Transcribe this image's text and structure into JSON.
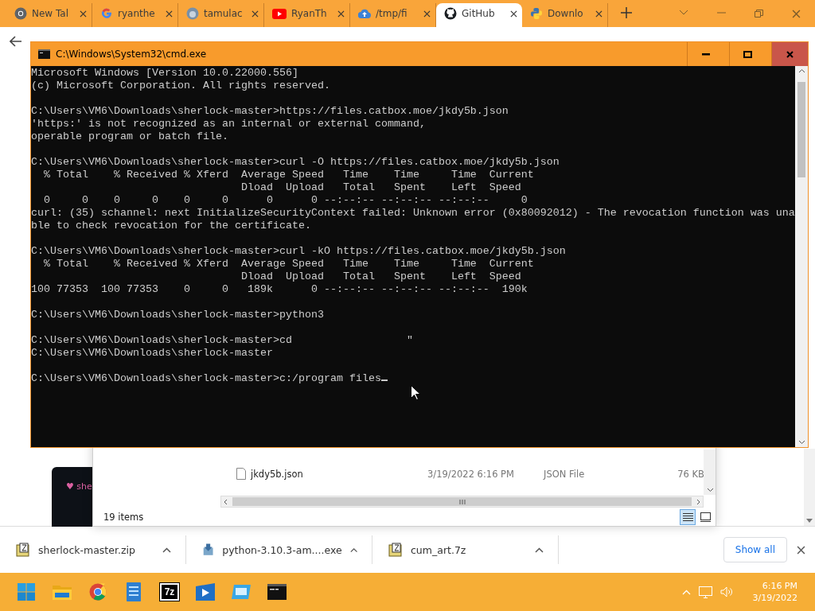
{
  "browser": {
    "tabs": [
      {
        "title": "New Tal",
        "kind": "browser",
        "selected": false
      },
      {
        "title": "ryanthe",
        "kind": "search",
        "selected": false
      },
      {
        "title": "tamulac",
        "kind": "avatar",
        "selected": false
      },
      {
        "title": "RyanTh",
        "kind": "video",
        "selected": false
      },
      {
        "title": "/tmp/fi",
        "kind": "cloud",
        "selected": false
      },
      {
        "title": "GitHub",
        "kind": "code",
        "selected": true
      },
      {
        "title": "Downlo",
        "kind": "snake",
        "selected": false
      }
    ],
    "card_text": "♥ she"
  },
  "explorer": {
    "rows": [
      {
        "name": "jkdy5b.json",
        "modified": "3/19/2022 6:16 PM",
        "type": "JSON File",
        "size": "76 KB"
      }
    ],
    "status": "19 items",
    "views": [
      {
        "kind": "details",
        "selected": true
      },
      {
        "kind": "tiles",
        "selected": false
      }
    ]
  },
  "terminal": {
    "title": "C:\\Windows\\System32\\cmd.exe",
    "blocks": [
      [
        "Microsoft Windows [Version 10.0.22000.556]",
        "(c) Microsoft Corporation. All rights reserved."
      ],
      [
        "C:\\Users\\VM6\\Downloads\\sherlock-master>https://files.catbox.moe/jkdy5b.json",
        "'https:' is not recognized as an internal or external command,",
        "operable program or batch file."
      ],
      [
        "C:\\Users\\VM6\\Downloads\\sherlock-master>curl -O https://files.catbox.moe/jkdy5b.json",
        "  % Total    % Received % Xferd  Average Speed   Time    Time     Time  Current",
        "                                 Dload  Upload   Total   Spent    Left  Speed",
        "  0     0    0     0    0     0      0      0 --:--:-- --:--:-- --:--:--     0",
        "curl: (35) schannel: next InitializeSecurityContext failed: Unknown error (0x80092012) - The revocation function was una",
        "ble to check revocation for the certificate."
      ],
      [
        "C:\\Users\\VM6\\Downloads\\sherlock-master>curl -kO https://files.catbox.moe/jkdy5b.json",
        "  % Total    % Received % Xferd  Average Speed   Time    Time     Time  Current",
        "                                 Dload  Upload   Total   Spent    Left  Speed",
        "100 77353  100 77353    0     0   189k      0 --:--:-- --:--:-- --:--:--  190k"
      ],
      [
        "C:\\Users\\VM6\\Downloads\\sherlock-master>python3"
      ],
      [
        "C:\\Users\\VM6\\Downloads\\sherlock-master>cd                  \"",
        "C:\\Users\\VM6\\Downloads\\sherlock-master"
      ]
    ],
    "input_line": "C:\\Users\\VM6\\Downloads\\sherlock-master>c:/program files"
  },
  "downloads": {
    "items": [
      {
        "name": "sherlock-master.zip",
        "kind": "archive"
      },
      {
        "name": "python-3.10.3-am....exe",
        "kind": "installer"
      },
      {
        "name": "cum_art.7z",
        "kind": "archive"
      }
    ],
    "show_all": "Show all"
  },
  "taskbar": {
    "apps": [
      {
        "kind": "start"
      },
      {
        "kind": "folder"
      },
      {
        "kind": "browser"
      },
      {
        "kind": "notepad"
      },
      {
        "kind": "archiver",
        "label": "7z"
      },
      {
        "kind": "media"
      },
      {
        "kind": "app"
      },
      {
        "kind": "terminal"
      }
    ],
    "time": "6:16 PM",
    "date": "3/19/2022"
  }
}
